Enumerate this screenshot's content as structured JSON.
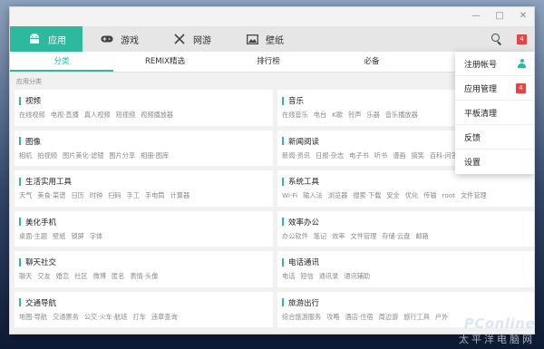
{
  "nav": {
    "items": [
      {
        "label": "应用",
        "icon": "android-icon",
        "active": true
      },
      {
        "label": "游戏",
        "icon": "gamepad-icon"
      },
      {
        "label": "网游",
        "icon": "swords-icon"
      },
      {
        "label": "壁纸",
        "icon": "image-icon"
      }
    ],
    "notification_count": "4"
  },
  "subtabs": [
    {
      "label": "分类",
      "active": true
    },
    {
      "label": "REMIX精选"
    },
    {
      "label": "排行榜"
    },
    {
      "label": "必备"
    }
  ],
  "section_title": "应用分类",
  "categories": [
    {
      "title": "视频",
      "tags": [
        "在线视频",
        "电视·直播",
        "真人视频",
        "短视频",
        "视频播放器"
      ]
    },
    {
      "title": "音乐",
      "tags": [
        "在线音乐",
        "电台",
        "K歌",
        "铃声",
        "乐器",
        "音乐播放器"
      ]
    },
    {
      "title": "图像",
      "tags": [
        "相机",
        "拍视频",
        "图片美化·滤镜",
        "图片分享",
        "相册·图库"
      ]
    },
    {
      "title": "新闻阅读",
      "tags": [
        "新闻·资讯",
        "日报·杂志",
        "电子书",
        "听书",
        "漫画",
        "搞笑",
        "百科·问答"
      ]
    },
    {
      "title": "生活实用工具",
      "tags": [
        "天气",
        "美食·菜谱",
        "日历",
        "时钟",
        "扫码",
        "手工",
        "手电筒",
        "计算器"
      ]
    },
    {
      "title": "系统工具",
      "tags": [
        "Wi-Fi",
        "输入法",
        "浏览器",
        "搜索·下载",
        "安全",
        "优化",
        "传输",
        "root",
        "文件管理"
      ]
    },
    {
      "title": "美化手机",
      "tags": [
        "桌面·主题",
        "壁纸",
        "锁屏",
        "字体"
      ]
    },
    {
      "title": "效率办公",
      "tags": [
        "办公软件",
        "笔记",
        "效率",
        "文件管理",
        "存储·云盘",
        "邮箱"
      ]
    },
    {
      "title": "聊天社交",
      "tags": [
        "聊天",
        "交友",
        "婚恋",
        "社区",
        "微博",
        "匿名",
        "表情·头像"
      ]
    },
    {
      "title": "电话通讯",
      "tags": [
        "电话",
        "短信",
        "通讯录",
        "通讯辅助"
      ]
    },
    {
      "title": "交通导航",
      "tags": [
        "地图·导航",
        "交通票务",
        "公交·火车·航班",
        "打车",
        "违章查询"
      ]
    },
    {
      "title": "旅游出行",
      "tags": [
        "综合旅游服务",
        "攻略",
        "酒店·住宿",
        "周边游",
        "旅行工具",
        "户外"
      ]
    }
  ],
  "dropdown": {
    "items": [
      {
        "label": "注册帐号",
        "icon": "user-icon"
      },
      {
        "label": "应用管理",
        "badge": "4"
      },
      {
        "label": "平板清理"
      },
      {
        "label": "反馈"
      },
      {
        "label": "设置"
      }
    ]
  },
  "watermark": {
    "line1": "PConline",
    "line2": "太平洋电脑网"
  },
  "colors": {
    "accent": "#2db99d",
    "badge": "#e84343"
  }
}
